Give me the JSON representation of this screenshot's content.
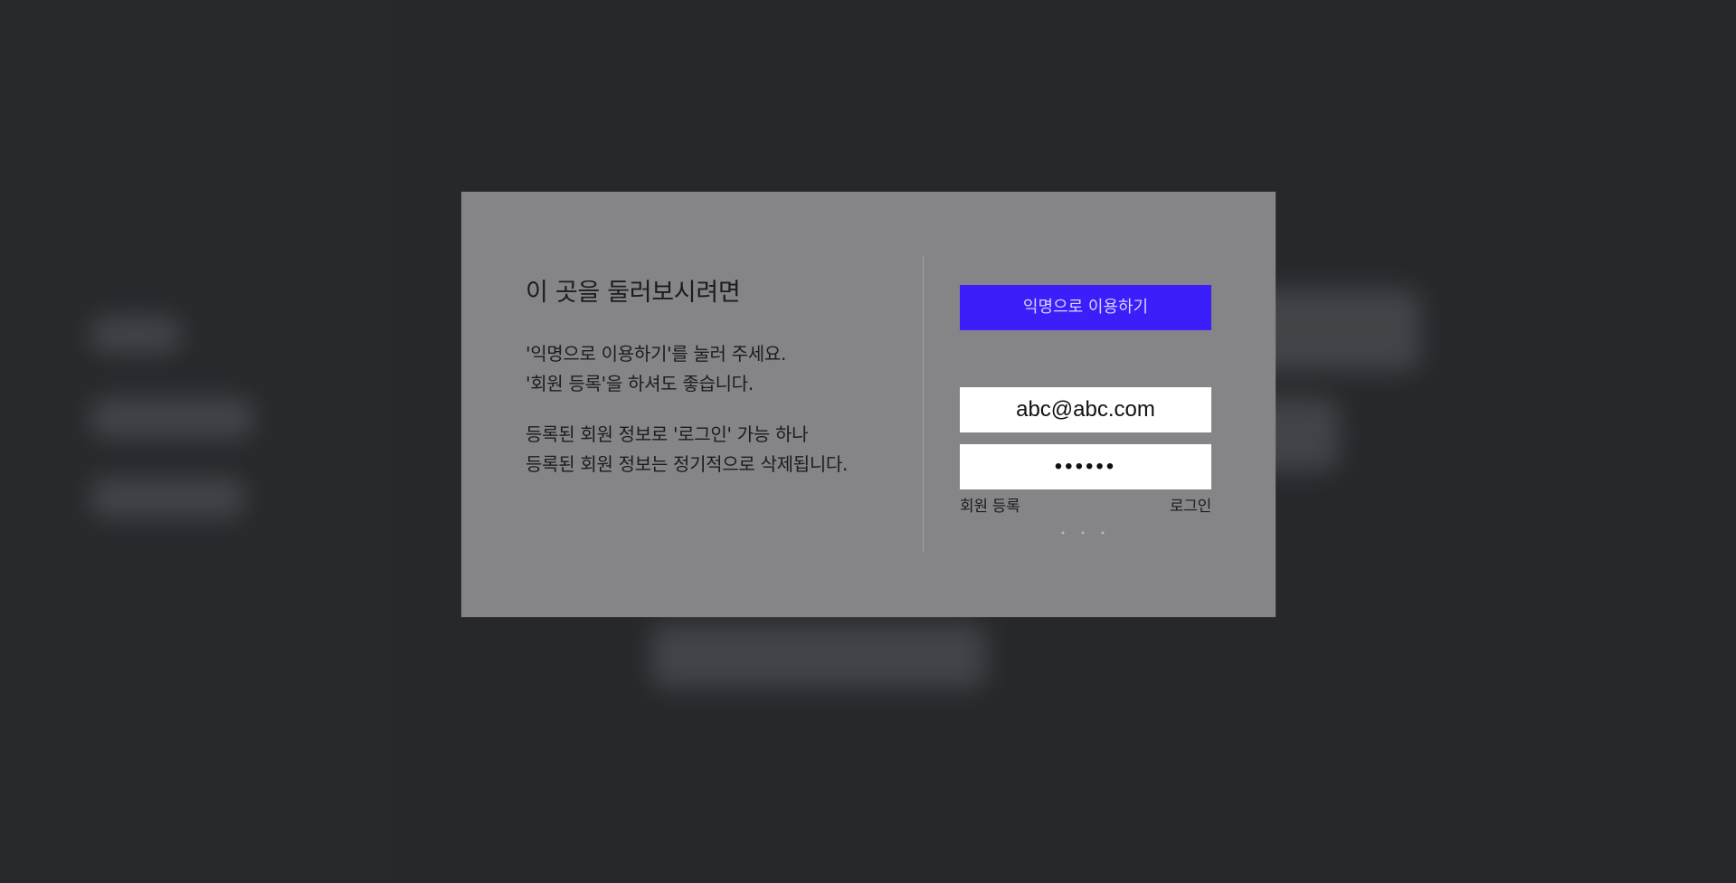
{
  "intro": {
    "heading": "이 곳을 둘러보시려면",
    "paragraph1": [
      "'익명으로 이용하기'를 눌러 주세요.",
      "'회원 등록'을 하셔도 좋습니다."
    ],
    "paragraph2": [
      "등록된 회원 정보로 '로그인' 가능 하나",
      "등록된 회원 정보는 정기적으로 삭제됩니다."
    ]
  },
  "auth": {
    "anonymous_label": "익명으로 이용하기",
    "email_value": "abc@abc.com",
    "password_value": "••••••",
    "register_label": "회원 등록",
    "login_label": "로그인",
    "more_indicator": "• • •"
  },
  "colors": {
    "accent": "#3c1efa",
    "modal_bg": "#858588",
    "page_bg": "#27282c"
  }
}
